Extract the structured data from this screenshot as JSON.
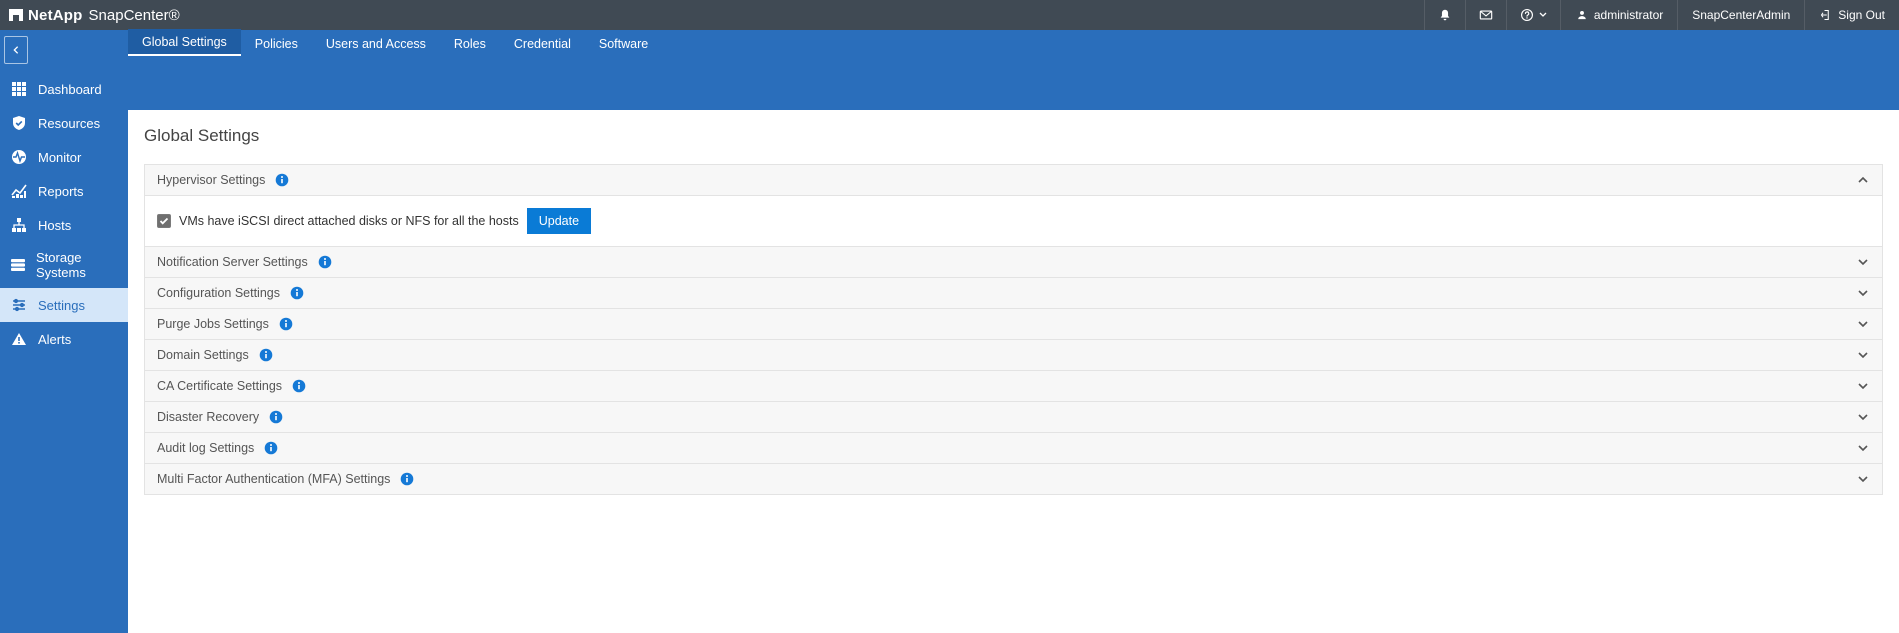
{
  "brand": {
    "company": "NetApp",
    "app": "SnapCenter®"
  },
  "topbar": {
    "user": "administrator",
    "role": "SnapCenterAdmin",
    "signout": "Sign Out"
  },
  "tabs": [
    {
      "label": "Global Settings",
      "active": true
    },
    {
      "label": "Policies"
    },
    {
      "label": "Users and Access"
    },
    {
      "label": "Roles"
    },
    {
      "label": "Credential"
    },
    {
      "label": "Software"
    }
  ],
  "sidebar": {
    "items": [
      {
        "label": "Dashboard",
        "icon": "grid"
      },
      {
        "label": "Resources",
        "icon": "shield"
      },
      {
        "label": "Monitor",
        "icon": "pulse"
      },
      {
        "label": "Reports",
        "icon": "chart"
      },
      {
        "label": "Hosts",
        "icon": "hosts"
      },
      {
        "label": "Storage Systems",
        "icon": "storage"
      },
      {
        "label": "Settings",
        "icon": "sliders",
        "active": true
      },
      {
        "label": "Alerts",
        "icon": "alert"
      }
    ]
  },
  "page": {
    "title": "Global Settings"
  },
  "panels": {
    "hypervisor": {
      "title": "Hypervisor Settings",
      "expanded": true,
      "checkbox_label": "VMs have iSCSI direct attached disks or NFS for all the hosts",
      "checked": true,
      "button": "Update"
    },
    "others": [
      {
        "title": "Notification Server Settings"
      },
      {
        "title": "Configuration Settings"
      },
      {
        "title": "Purge Jobs Settings"
      },
      {
        "title": "Domain Settings"
      },
      {
        "title": "CA Certificate Settings"
      },
      {
        "title": "Disaster Recovery"
      },
      {
        "title": "Audit log Settings"
      },
      {
        "title": "Multi Factor Authentication (MFA) Settings"
      }
    ]
  },
  "colors": {
    "accent": "#2a6ebb",
    "primaryBtn": "#0a7bd6",
    "topbar": "#404a54"
  }
}
